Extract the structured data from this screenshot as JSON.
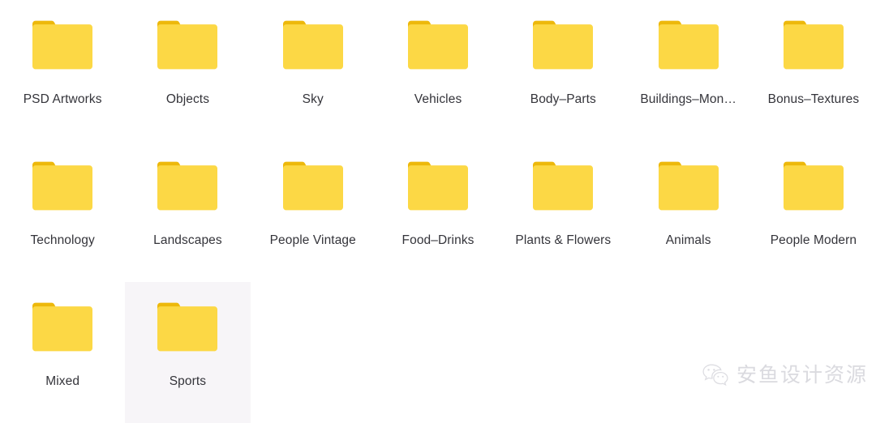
{
  "window": {
    "background_color": "#ffffff",
    "view_mode": "icon-grid"
  },
  "grid": {
    "columns": 7,
    "rows": 3,
    "folder_body_color": "#fcd845",
    "folder_tab_color": "#edb80b",
    "label_color": "#34343a",
    "selection_color": "#f7f5f8",
    "items": [
      {
        "label": "PSD Artworks",
        "icon": "folder-icon",
        "selected": false
      },
      {
        "label": "Objects",
        "icon": "folder-icon",
        "selected": false
      },
      {
        "label": "Sky",
        "icon": "folder-icon",
        "selected": false
      },
      {
        "label": "Vehicles",
        "icon": "folder-icon",
        "selected": false
      },
      {
        "label": "Body–Parts",
        "icon": "folder-icon",
        "selected": false
      },
      {
        "label": "Buildings–Mon…",
        "icon": "folder-icon",
        "selected": false
      },
      {
        "label": "Bonus–Textures",
        "icon": "folder-icon",
        "selected": false
      },
      {
        "label": "Technology",
        "icon": "folder-icon",
        "selected": false
      },
      {
        "label": "Landscapes",
        "icon": "folder-icon",
        "selected": false
      },
      {
        "label": "People Vintage",
        "icon": "folder-icon",
        "selected": false
      },
      {
        "label": "Food–Drinks",
        "icon": "folder-icon",
        "selected": false
      },
      {
        "label": "Plants & Flowers",
        "icon": "folder-icon",
        "selected": false
      },
      {
        "label": "Animals",
        "icon": "folder-icon",
        "selected": false
      },
      {
        "label": "People Modern",
        "icon": "folder-icon",
        "selected": false
      },
      {
        "label": "Mixed",
        "icon": "folder-icon",
        "selected": false
      },
      {
        "label": "Sports",
        "icon": "folder-icon",
        "selected": true
      }
    ]
  },
  "watermark": {
    "icon": "wechat-logo-icon",
    "text": "安鱼设计资源",
    "color": "#d9d9de"
  }
}
